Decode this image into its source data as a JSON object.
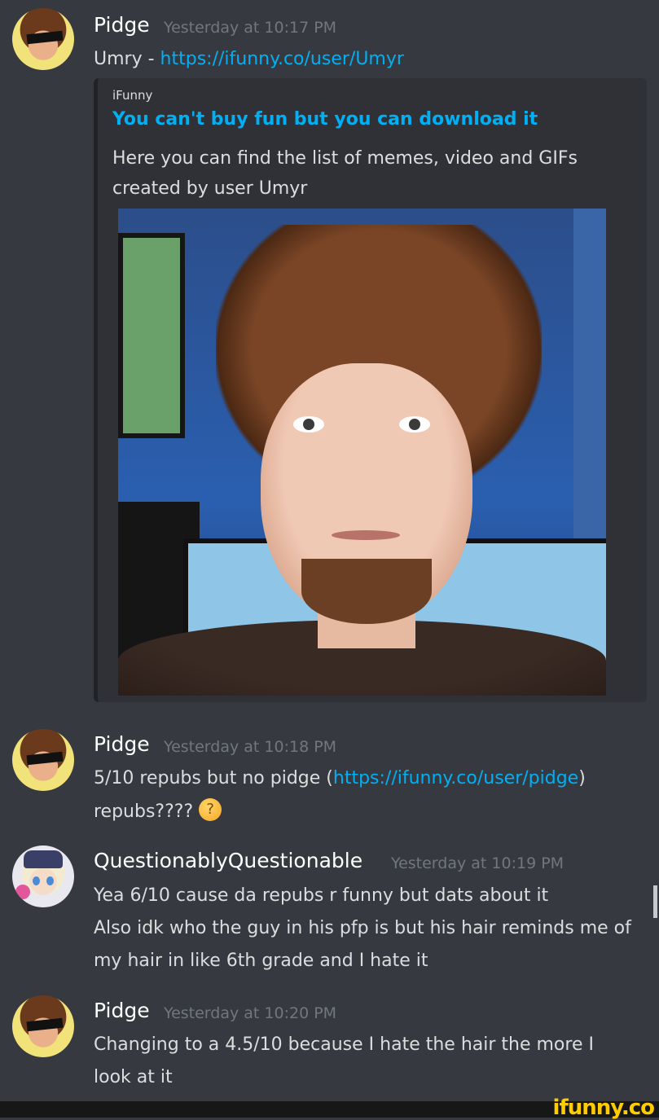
{
  "messages": [
    {
      "author": "Pidge",
      "timestamp": "Yesterday at 10:17 PM",
      "text_prefix": "Umry - ",
      "link": "https://ifunny.co/user/Umyr",
      "embed": {
        "provider": "iFunny",
        "title": "You can't buy fun but you can download it",
        "description_line1": "Here you can find the list of memes, video and GIFs",
        "description_line2": "created by user Umyr"
      }
    },
    {
      "author": "Pidge",
      "timestamp": "Yesterday at 10:18 PM",
      "line1_prefix": "5/10 repubs but no pidge (",
      "line1_link": "https://ifunny.co/user/pidge",
      "line1_suffix": ")",
      "line2": "repubs????",
      "emoji": "thinking-face"
    },
    {
      "author": "QuestionablyQuestionable",
      "timestamp": "Yesterday at 10:19 PM",
      "lines": [
        "Yea 6/10 cause da repubs r funny but dats about it",
        "Also idk who the guy in his pfp is but his hair reminds me of",
        "my hair in like 6th grade and I hate it"
      ]
    },
    {
      "author": "Pidge",
      "timestamp": "Yesterday at 10:20 PM",
      "lines": [
        "Changing to a 4.5/10 because I hate the hair the more I",
        "look at it"
      ]
    }
  ],
  "watermark": "ifunny.co",
  "colors": {
    "background": "#36393f",
    "embed_background": "#2f3136",
    "link": "#00b0f4",
    "timestamp": "#72767d",
    "watermark": "#ffcc00"
  }
}
